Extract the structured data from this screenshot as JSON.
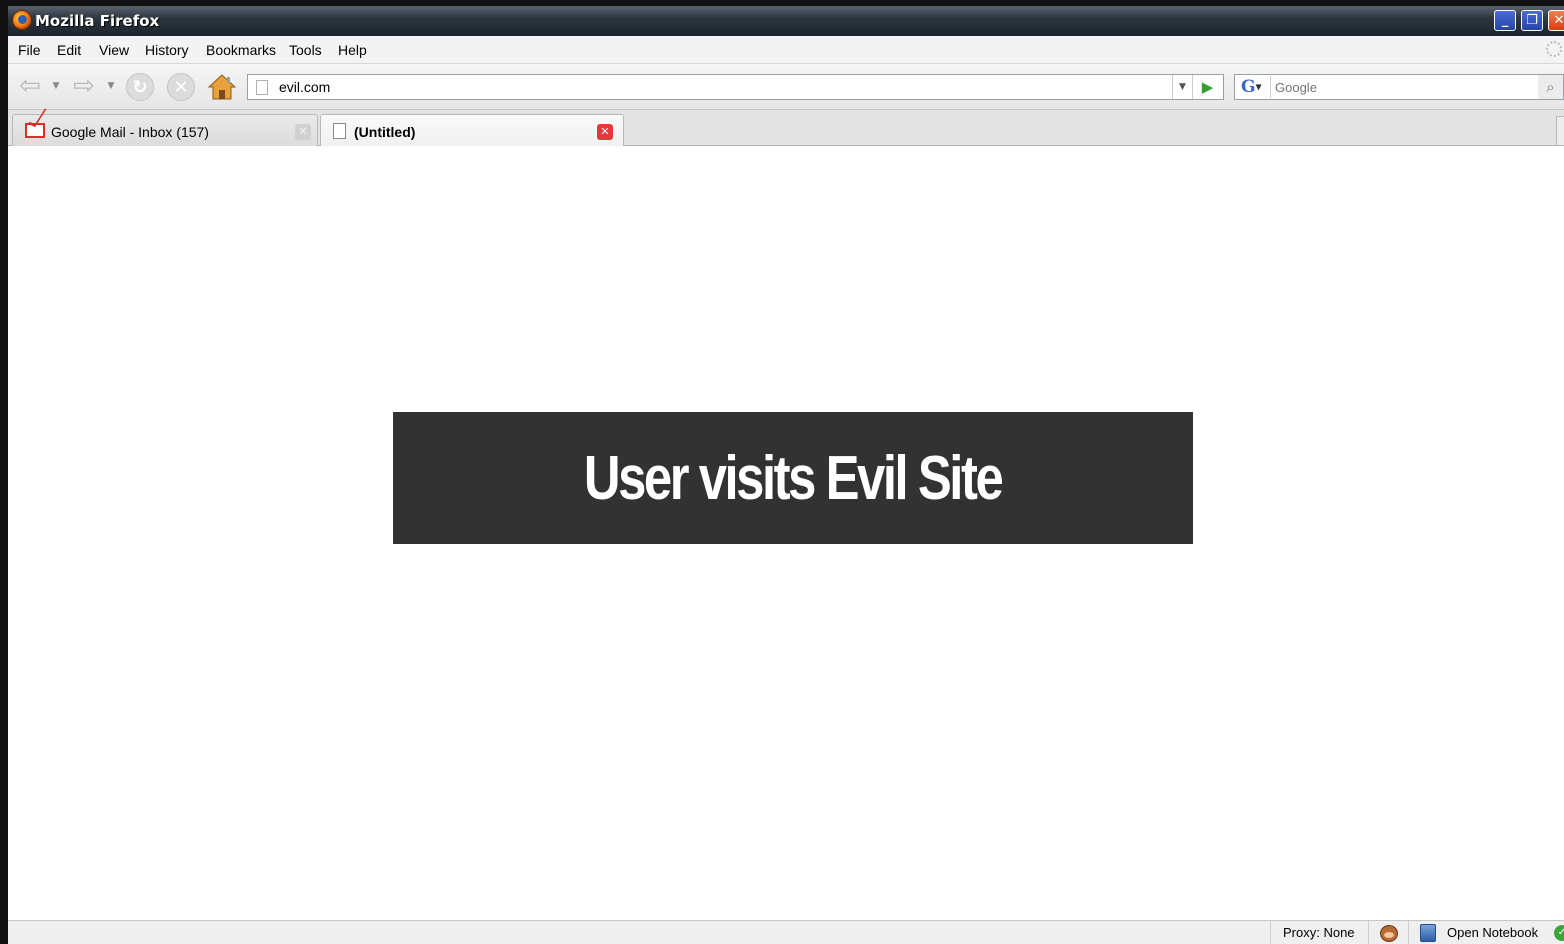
{
  "window": {
    "title": "Mozilla Firefox",
    "controls": {
      "minimize": "_",
      "maximize": "❐",
      "close": "✕"
    }
  },
  "menu": {
    "items": [
      "File",
      "Edit",
      "View",
      "History",
      "Bookmarks",
      "Tools",
      "Help"
    ]
  },
  "toolbar": {
    "back_icon": "back-arrow-icon",
    "forward_icon": "forward-arrow-icon",
    "reload_icon": "reload-icon",
    "stop_icon": "stop-icon",
    "home_icon": "home-icon"
  },
  "address_bar": {
    "url": "evil.com"
  },
  "search": {
    "placeholder": "Google",
    "engine": "G"
  },
  "tabs": [
    {
      "label": "Google Mail - Inbox (157)",
      "icon": "gmail-icon",
      "active": false
    },
    {
      "label": "(Untitled)",
      "icon": "document-icon",
      "active": true
    }
  ],
  "content": {
    "banner_text": "User visits Evil Site"
  },
  "status": {
    "proxy": "Proxy: None",
    "notebook": "Open Notebook"
  },
  "colors": {
    "banner_bg": "#323232",
    "tab_close_active": "#e03a3a",
    "go_arrow": "#35a030"
  }
}
